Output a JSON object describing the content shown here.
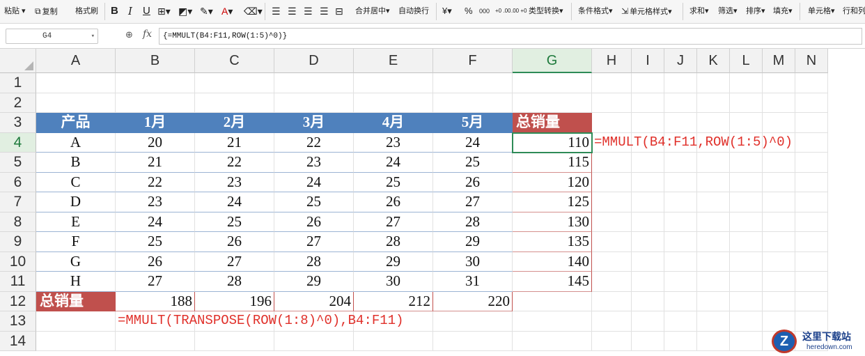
{
  "toolbar": {
    "paste": "粘贴",
    "copy": "复制",
    "format_painter": "格式刷",
    "bold": "B",
    "italic": "I",
    "underline": "U",
    "merge_center": "合并居中",
    "wrap_text": "自动换行",
    "currency": "¥",
    "percent": "%",
    "thousands": "000",
    "inc_decimal": "+0 .00",
    "dec_decimal": ".00 +0",
    "type_convert": "类型转换",
    "cond_format": "条件格式",
    "cell_style": "单元格样式",
    "sum": "求和",
    "filter": "筛选",
    "sort": "排序",
    "fill": "填充",
    "cell": "单元格",
    "row_col": "行和列"
  },
  "formula_bar": {
    "name_box": "G4",
    "fx": "fx",
    "formula": "{=MMULT(B4:F11,ROW(1:5)^0)}"
  },
  "columns": [
    "A",
    "B",
    "C",
    "D",
    "E",
    "F",
    "G",
    "H",
    "I",
    "J",
    "K",
    "L",
    "M",
    "N"
  ],
  "rows": [
    "1",
    "2",
    "3",
    "4",
    "5",
    "6",
    "7",
    "8",
    "9",
    "10",
    "11",
    "12",
    "13",
    "14"
  ],
  "selected": {
    "column": "G",
    "row": "4"
  },
  "sheet": {
    "header": [
      "产品",
      "1月",
      "2月",
      "3月",
      "4月",
      "5月",
      "总销量"
    ],
    "data": [
      [
        "A",
        "20",
        "21",
        "22",
        "23",
        "24",
        "110"
      ],
      [
        "B",
        "21",
        "22",
        "23",
        "24",
        "25",
        "115"
      ],
      [
        "C",
        "22",
        "23",
        "24",
        "25",
        "26",
        "120"
      ],
      [
        "D",
        "23",
        "24",
        "25",
        "26",
        "27",
        "125"
      ],
      [
        "E",
        "24",
        "25",
        "26",
        "27",
        "28",
        "130"
      ],
      [
        "F",
        "25",
        "26",
        "27",
        "28",
        "29",
        "135"
      ],
      [
        "G",
        "26",
        "27",
        "28",
        "29",
        "30",
        "140"
      ],
      [
        "H",
        "27",
        "28",
        "29",
        "30",
        "31",
        "145"
      ]
    ],
    "total_label": "总销量",
    "totals": [
      "188",
      "196",
      "204",
      "212",
      "220"
    ],
    "formula_note_row": "=MMULT(B4:F11,ROW(1:5)^0)",
    "formula_note_col": "=MMULT(TRANSPOSE(ROW(1:8)^0),B4:F11)"
  },
  "colors": {
    "header_blue": "#4f81bd",
    "total_red": "#c0504d",
    "note_red": "#e0302a",
    "selection_green": "#2e8b57"
  },
  "watermark": {
    "logo_letter": "Z",
    "cn": "这里下载站",
    "en": "heredown.com"
  }
}
